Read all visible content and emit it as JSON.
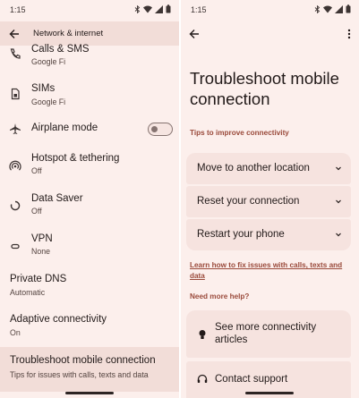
{
  "left": {
    "status": {
      "time": "1:15"
    },
    "header": {
      "title": "Network & internet"
    },
    "items": [
      {
        "title": "Calls & SMS",
        "subtitle": "Google Fi"
      },
      {
        "title": "SIMs",
        "subtitle": "Google Fi"
      },
      {
        "title": "Airplane mode",
        "toggle_on": false
      },
      {
        "title": "Hotspot & tethering",
        "subtitle": "Off"
      },
      {
        "title": "Data Saver",
        "subtitle": "Off"
      },
      {
        "title": "VPN",
        "subtitle": "None"
      },
      {
        "title": "Private DNS",
        "subtitle": "Automatic"
      },
      {
        "title": "Adaptive connectivity",
        "subtitle": "On"
      },
      {
        "title": "Troubleshoot mobile connection",
        "subtitle": "Tips for issues with calls, texts and data"
      }
    ]
  },
  "right": {
    "status": {
      "time": "1:15"
    },
    "title": "Troubleshoot mobile connection",
    "tips_heading": "Tips to improve connectivity",
    "tips": [
      {
        "label": "Move to another location"
      },
      {
        "label": "Reset your connection"
      },
      {
        "label": "Restart your phone"
      }
    ],
    "learn_link": "Learn how to fix issues with calls, texts and data",
    "help_heading": "Need more help?",
    "help_items": [
      {
        "label": "See more connectivity articles",
        "icon": "lightbulb-icon"
      },
      {
        "label": "Contact support",
        "icon": "headset-icon"
      }
    ]
  },
  "colors": {
    "accent": "#9a4a3b",
    "background": "#fcefec",
    "card": "#f6e3df"
  }
}
